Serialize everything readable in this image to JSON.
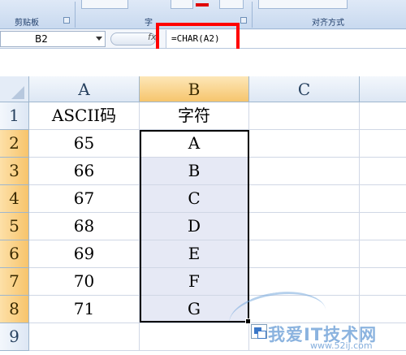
{
  "ribbon": {
    "groups": [
      {
        "label": "剪贴板"
      },
      {
        "label": "字"
      },
      {
        "label": "对齐方式"
      }
    ]
  },
  "formula_bar": {
    "name_box": "B2",
    "fx": "fx",
    "formula": "=CHAR(A2)"
  },
  "columns": [
    "A",
    "B",
    "C"
  ],
  "rows": [
    {
      "num": "1",
      "a": "ASCII码",
      "b": "字符"
    },
    {
      "num": "2",
      "a": "65",
      "b": "A"
    },
    {
      "num": "3",
      "a": "66",
      "b": "B"
    },
    {
      "num": "4",
      "a": "67",
      "b": "C"
    },
    {
      "num": "5",
      "a": "68",
      "b": "D"
    },
    {
      "num": "6",
      "a": "69",
      "b": "E"
    },
    {
      "num": "7",
      "a": "70",
      "b": "F"
    },
    {
      "num": "8",
      "a": "71",
      "b": "G"
    },
    {
      "num": "9",
      "a": "",
      "b": ""
    }
  ],
  "watermark": {
    "text": "我爱IT技术网",
    "url": "www.52ij.com"
  },
  "colors": {
    "selected_header": "#f7c46b",
    "highlight": "#ff0000",
    "selection_fill": "#e6e9f5"
  }
}
